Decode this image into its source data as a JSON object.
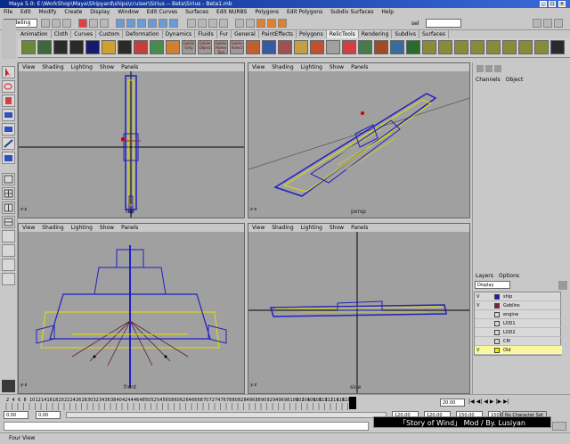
{
  "window": {
    "title": "Maya 5.0: E:\\WorkShop\\Maya\\Shipyard\\ships\\cruiser\\Sirius -- Beta\\Sirius - Beta1.mb"
  },
  "menu": [
    "File",
    "Edit",
    "Modify",
    "Create",
    "Display",
    "Window",
    "Edit Curves",
    "Surfaces",
    "Edit NURBS",
    "Polygons",
    "Edit Polygons",
    "Subdiv Surfaces",
    "Help"
  ],
  "status": {
    "mode": "Modeling",
    "sel_label": "sel"
  },
  "shelf_tabs": [
    "Animation",
    "Cloth",
    "Curves",
    "Custom",
    "Deformation",
    "Dynamics",
    "Fluids",
    "Fur",
    "General",
    "PaintEffects",
    "Polygons",
    "RelicTools",
    "Rendering",
    "Subdivs",
    "Surfaces"
  ],
  "shelf_active": "RelicTools",
  "shelf_icons": [
    "Goblin Only",
    "Goblin Object",
    "Goblin Home Tool",
    "Goblin Select"
  ],
  "viewports": {
    "menu": [
      "View",
      "Shading",
      "Lighting",
      "Show",
      "Panels"
    ],
    "top": {
      "label": "top"
    },
    "persp": {
      "label": "persp"
    },
    "front": {
      "label": "front"
    },
    "side": {
      "label": "side"
    }
  },
  "channels": {
    "menu": [
      "Channels",
      "Object"
    ]
  },
  "layers": {
    "menu": [
      "Layers",
      "Options"
    ],
    "display": "Display",
    "rows": [
      {
        "v": "V",
        "name": "ship",
        "color": "#1a1ad0"
      },
      {
        "v": "V",
        "name": "Goblins",
        "color": "#8a1a4a"
      },
      {
        "v": "",
        "name": "engine",
        "color": "#d8d8d8"
      },
      {
        "v": "",
        "name": "LOD1",
        "color": "#d8d8d8"
      },
      {
        "v": "",
        "name": "LOD2",
        "color": "#d8d8d8"
      },
      {
        "v": "",
        "name": "CM",
        "color": "#d8d8d8"
      },
      {
        "v": "V",
        "name": "Old",
        "color": "#f0f000"
      }
    ]
  },
  "timeline": {
    "ticks": [
      "2",
      "4",
      "6",
      "8",
      "10",
      "12",
      "14",
      "16",
      "18",
      "20",
      "22",
      "24",
      "26",
      "28",
      "30",
      "32",
      "34",
      "36",
      "38",
      "40",
      "42",
      "44",
      "46",
      "48",
      "50",
      "52",
      "54",
      "56",
      "58",
      "60",
      "62",
      "64",
      "66",
      "68",
      "70",
      "72",
      "74",
      "76",
      "78",
      "80",
      "82",
      "84",
      "86",
      "88",
      "90",
      "92",
      "94",
      "96",
      "98",
      "100",
      "102",
      "104",
      "106",
      "108",
      "110",
      "112",
      "114",
      "116",
      "118",
      "120"
    ],
    "current": "20.00"
  },
  "range": {
    "start": "0.00",
    "start2": "0.00",
    "end": "120.00",
    "end2": "120.00",
    "end_total": "150.00",
    "current_field": "150.00",
    "no_char": "No Character Set"
  },
  "credit": "「Story of Wind」 Mod / By. Lusiyan",
  "help": "Four View"
}
